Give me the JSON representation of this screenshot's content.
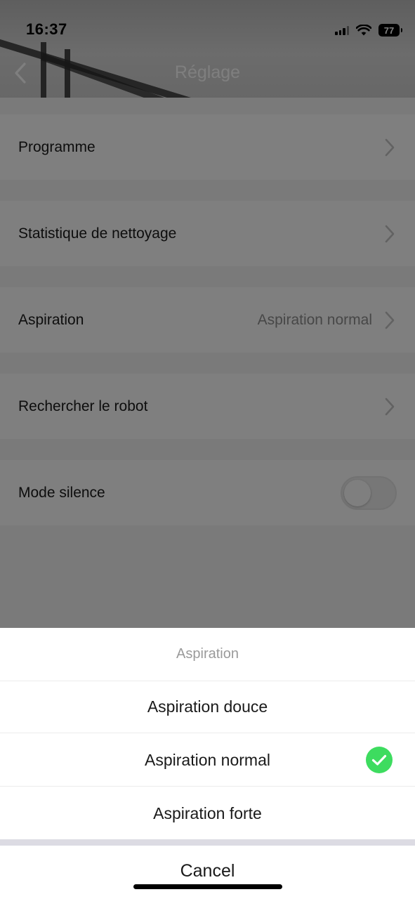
{
  "status_bar": {
    "time": "16:37",
    "battery": "77"
  },
  "header": {
    "title": "Réglage"
  },
  "settings": {
    "items": [
      {
        "label": "Programme",
        "value": ""
      },
      {
        "label": "Statistique de nettoyage",
        "value": ""
      },
      {
        "label": "Aspiration",
        "value": "Aspiration normal"
      },
      {
        "label": "Rechercher le robot",
        "value": ""
      },
      {
        "label": "Mode silence",
        "toggle_on": false
      }
    ]
  },
  "action_sheet": {
    "title": "Aspiration",
    "options": [
      {
        "label": "Aspiration douce",
        "selected": false
      },
      {
        "label": "Aspiration normal",
        "selected": true
      },
      {
        "label": "Aspiration forte",
        "selected": false
      }
    ],
    "cancel_label": "Cancel"
  },
  "colors": {
    "check_green": "#3ddc5f",
    "overlay": "rgba(0,0,0,0.5)",
    "divider": "#dcdbe3"
  }
}
